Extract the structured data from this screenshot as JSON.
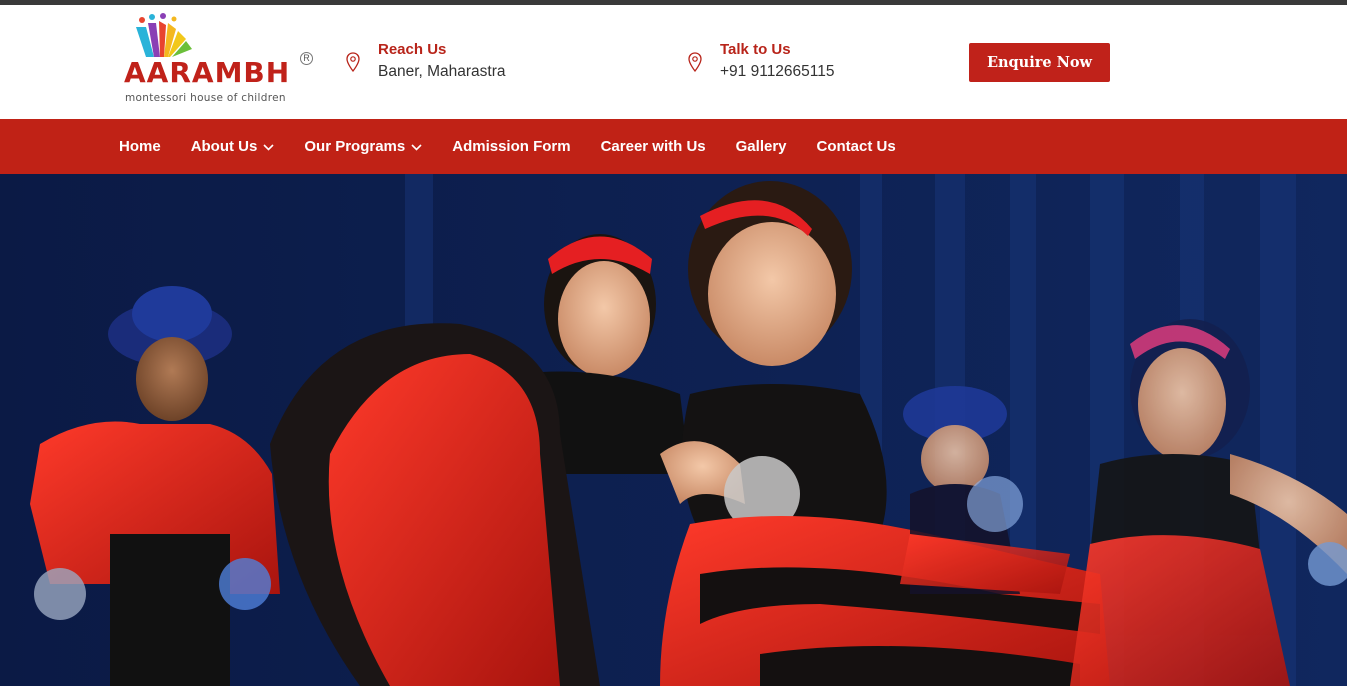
{
  "brand": {
    "name": "AARAMBH",
    "tagline": "montessori house of children",
    "registered_mark": "R",
    "colors": {
      "primary": "#c0221a",
      "nav": "#c02216",
      "text": "#333333"
    }
  },
  "header": {
    "reach": {
      "title": "Reach Us",
      "value": "Baner, Maharastra",
      "icon": "map-pin-icon"
    },
    "talk": {
      "title": "Talk to Us",
      "value": "+91 9112665115",
      "icon": "map-pin-icon"
    },
    "enquire_label": "Enquire Now"
  },
  "nav": {
    "items": [
      {
        "label": "Home",
        "has_dropdown": false
      },
      {
        "label": "About Us",
        "has_dropdown": true
      },
      {
        "label": "Our Programs",
        "has_dropdown": true
      },
      {
        "label": "Admission Form",
        "has_dropdown": false
      },
      {
        "label": "Career with Us",
        "has_dropdown": false
      },
      {
        "label": "Gallery",
        "has_dropdown": false
      },
      {
        "label": "Contact Us",
        "has_dropdown": false
      }
    ]
  },
  "hero": {
    "image": "children-dance-performance-photo"
  }
}
